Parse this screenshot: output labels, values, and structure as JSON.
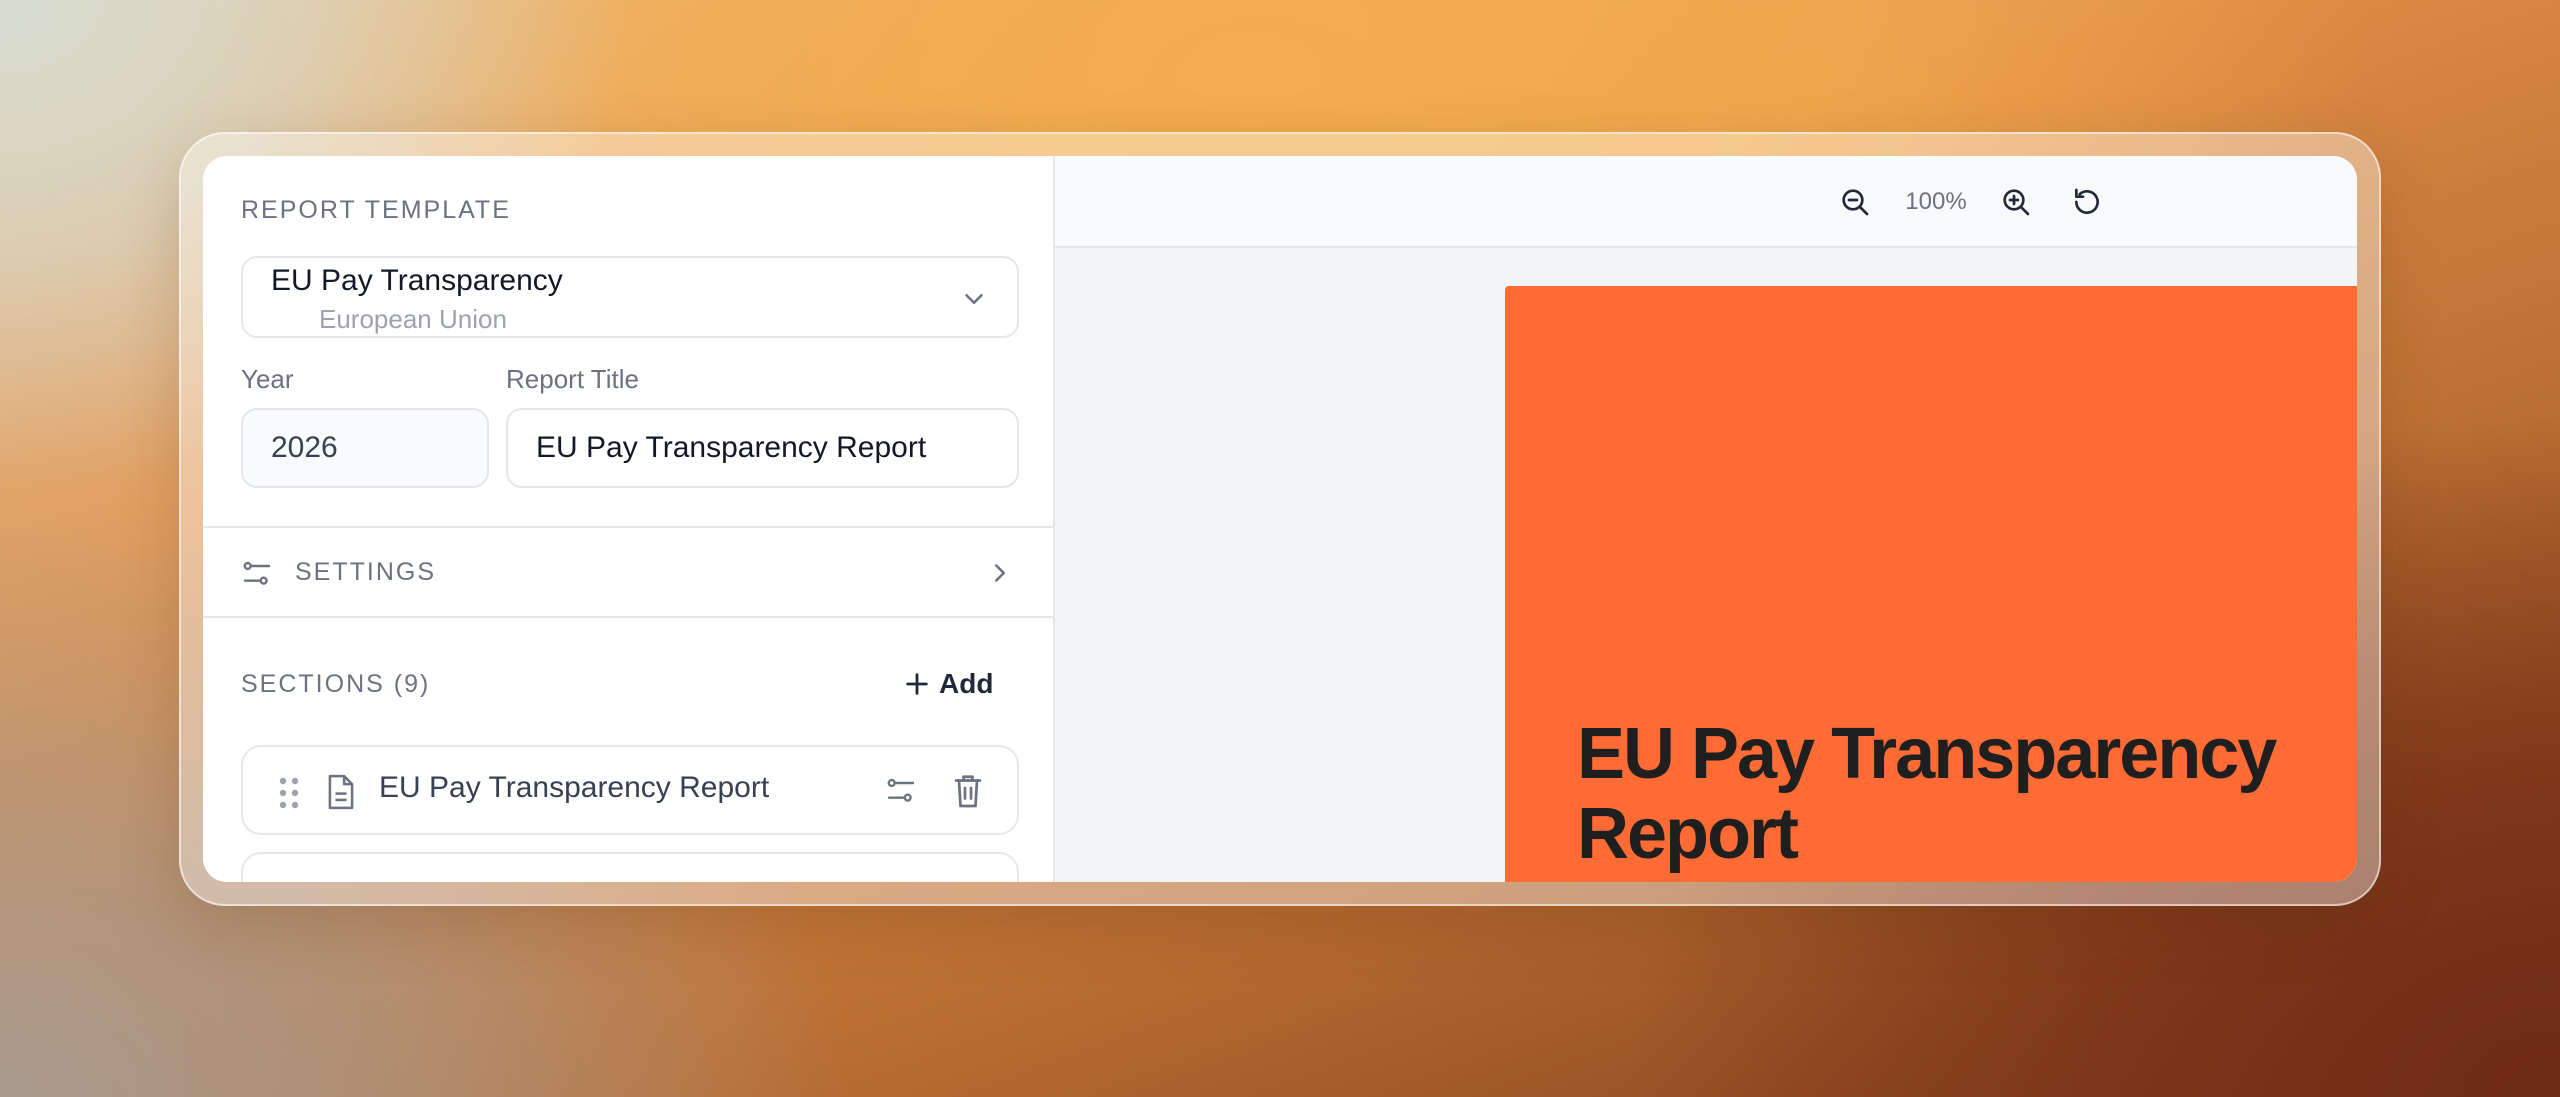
{
  "template": {
    "label": "Report Template",
    "selected_name": "EU Pay Transparency",
    "selected_region": "European Union"
  },
  "fields": {
    "year_label": "Year",
    "year_value": "2026",
    "title_label": "Report Title",
    "title_value": "EU Pay Transparency Report"
  },
  "settings": {
    "label": "Settings"
  },
  "sections": {
    "label": "Sections (9)",
    "add_label": "Add",
    "items": [
      {
        "title": "EU Pay Transparency Report"
      },
      {
        "title": ""
      }
    ]
  },
  "preview": {
    "zoom": "100%",
    "page_title": "EU Pay Transparency Report",
    "page_color": "#ff6b35"
  },
  "icons": [
    "chevron-down-icon",
    "sliders-icon",
    "chevron-right-icon",
    "plus-icon",
    "grip-icon",
    "document-icon",
    "trash-icon",
    "zoom-out-icon",
    "zoom-in-icon",
    "reset-icon"
  ]
}
